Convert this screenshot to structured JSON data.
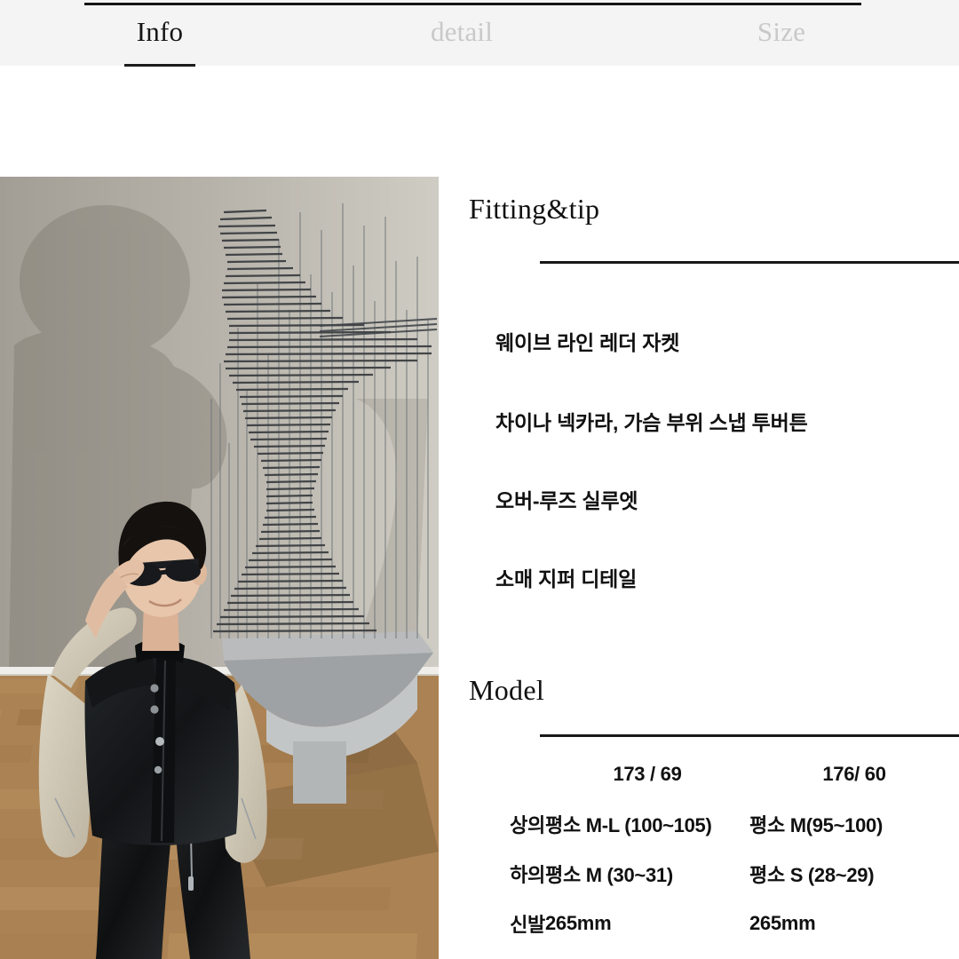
{
  "tabs": [
    {
      "label": "Info",
      "active": true
    },
    {
      "label": "detail",
      "active": false
    },
    {
      "label": "Size",
      "active": false
    }
  ],
  "photo": {
    "alt": "Model wearing black and cream wave-line leather jacket in gallery with kinetic metal sculpture",
    "colors": {
      "wall": "#a9a69f",
      "wall_light": "#d5d2cb",
      "shadow": "#8d877d",
      "floor": "#a97f4e",
      "floor_dark": "#6d4f2e",
      "jacket_black": "#16181a",
      "jacket_cream": "#cfc7b4",
      "sculpture": "#4a4c4f",
      "skin": "#e6c4a9",
      "hair": "#15120f",
      "shirt": "#f2f0eb"
    }
  },
  "fitting": {
    "heading": "Fitting&tip",
    "features": [
      "웨이브 라인 레더 자켓",
      "차이나 넥카라, 가슴 부위 스냅 투버튼",
      "오버-루즈 실루엣",
      "소매 지퍼 디테일"
    ]
  },
  "model": {
    "heading": "Model",
    "columns": [
      "",
      "173 / 69",
      "176/ 60"
    ],
    "rows": [
      {
        "label": "상의",
        "a": "평소 M-L (100~105)",
        "b": "평소 M(95~100)"
      },
      {
        "label": "하의",
        "a": "평소 M (30~31)",
        "b": "평소 S (28~29)"
      },
      {
        "label": "신발",
        "a": "265mm",
        "b": "265mm"
      }
    ]
  },
  "theme": {
    "header_bg": "#f4f4f4",
    "rule": "#181818",
    "text": "#111111",
    "inactive_tab": "#c9c9c9"
  }
}
